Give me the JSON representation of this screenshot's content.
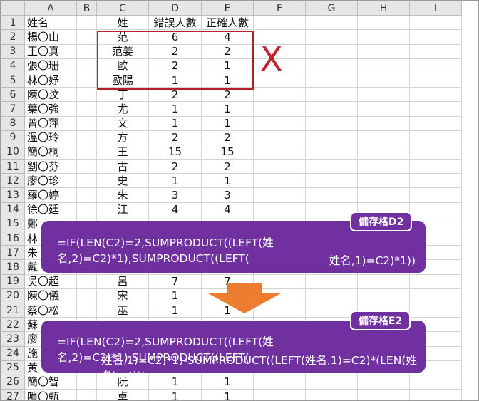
{
  "columns": [
    "A",
    "B",
    "C",
    "D",
    "E",
    "F",
    "G",
    "H",
    "I"
  ],
  "rows": [
    {
      "n": "1",
      "a": "姓名",
      "c": "姓",
      "d": "錯誤人數",
      "e": "正確人數"
    },
    {
      "n": "2",
      "a": "楊〇山",
      "c": "范",
      "d": "6",
      "e": "4"
    },
    {
      "n": "3",
      "a": "王〇真",
      "c": "范姜",
      "d": "2",
      "e": "2"
    },
    {
      "n": "4",
      "a": "張〇珊",
      "c": "歐",
      "d": "2",
      "e": "1"
    },
    {
      "n": "5",
      "a": "林〇妤",
      "c": "歐陽",
      "d": "1",
      "e": "1"
    },
    {
      "n": "6",
      "a": "陳〇汶",
      "c": "丁",
      "d": "2",
      "e": "2"
    },
    {
      "n": "7",
      "a": "葉〇強",
      "c": "尤",
      "d": "1",
      "e": "1"
    },
    {
      "n": "8",
      "a": "曾〇萍",
      "c": "文",
      "d": "1",
      "e": "1"
    },
    {
      "n": "9",
      "a": "溫〇玲",
      "c": "方",
      "d": "2",
      "e": "2"
    },
    {
      "n": "10",
      "a": "簡〇桐",
      "c": "王",
      "d": "15",
      "e": "15"
    },
    {
      "n": "11",
      "a": "劉〇芬",
      "c": "古",
      "d": "2",
      "e": "2"
    },
    {
      "n": "12",
      "a": "廖〇珍",
      "c": "史",
      "d": "1",
      "e": "1"
    },
    {
      "n": "13",
      "a": "羅〇婷",
      "c": "朱",
      "d": "3",
      "e": "3"
    },
    {
      "n": "14",
      "a": "徐〇廷",
      "c": "江",
      "d": "4",
      "e": "4"
    },
    {
      "n": "15",
      "a": "鄭",
      "c": "",
      "d": "",
      "e": ""
    },
    {
      "n": "16",
      "a": "林",
      "c": "",
      "d": "",
      "e": ""
    },
    {
      "n": "17",
      "a": "朱",
      "c": "",
      "d": "",
      "e": ""
    },
    {
      "n": "18",
      "a": "戴",
      "c": "",
      "d": "",
      "e": ""
    },
    {
      "n": "19",
      "a": "吳〇超",
      "c": "呂",
      "d": "7",
      "e": "7"
    },
    {
      "n": "20",
      "a": "陳〇儀",
      "c": "宋",
      "d": "1",
      "e": ""
    },
    {
      "n": "21",
      "a": "蔡〇松",
      "c": "巫",
      "d": "1",
      "e": "1"
    },
    {
      "n": "22",
      "a": "蘇",
      "c": "",
      "d": "",
      "e": ""
    },
    {
      "n": "23",
      "a": "廖",
      "c": "",
      "d": "",
      "e": ""
    },
    {
      "n": "24",
      "a": "施",
      "c": "",
      "d": "",
      "e": ""
    },
    {
      "n": "25",
      "a": "黃",
      "c": "",
      "d": "",
      "e": ""
    },
    {
      "n": "26",
      "a": "簡〇智",
      "c": "阮",
      "d": "1",
      "e": "1"
    },
    {
      "n": "27",
      "a": "嗩〇甄",
      "c": "卓",
      "d": "1",
      "e": "1"
    }
  ],
  "annotation": {
    "x_mark": "X",
    "callout_d2": {
      "tag": "儲存格D2",
      "line1": "=IF(LEN(C2)=2,SUMPRODUCT((LEFT(姓名,2)=C2)*1),SUMPRODUCT((LEFT(",
      "line2": "姓名,1)=C2)*1))"
    },
    "callout_e2": {
      "tag": "儲存格E2",
      "line1": "=IF(LEN(C2)=2,SUMPRODUCT((LEFT(姓名,2)=C2)*1),SUMPRODUCT((LEFT(",
      "line2": "姓名,1)=C2)*1)-SUMPRODUCT((LEFT(姓名,1)=C2)*(LEN(姓名)=4)))"
    }
  },
  "colors": {
    "callout": "#7030a0",
    "highlight_border": "#b3202a",
    "x_mark": "#c0242c",
    "arrow": "#ed7d31"
  }
}
